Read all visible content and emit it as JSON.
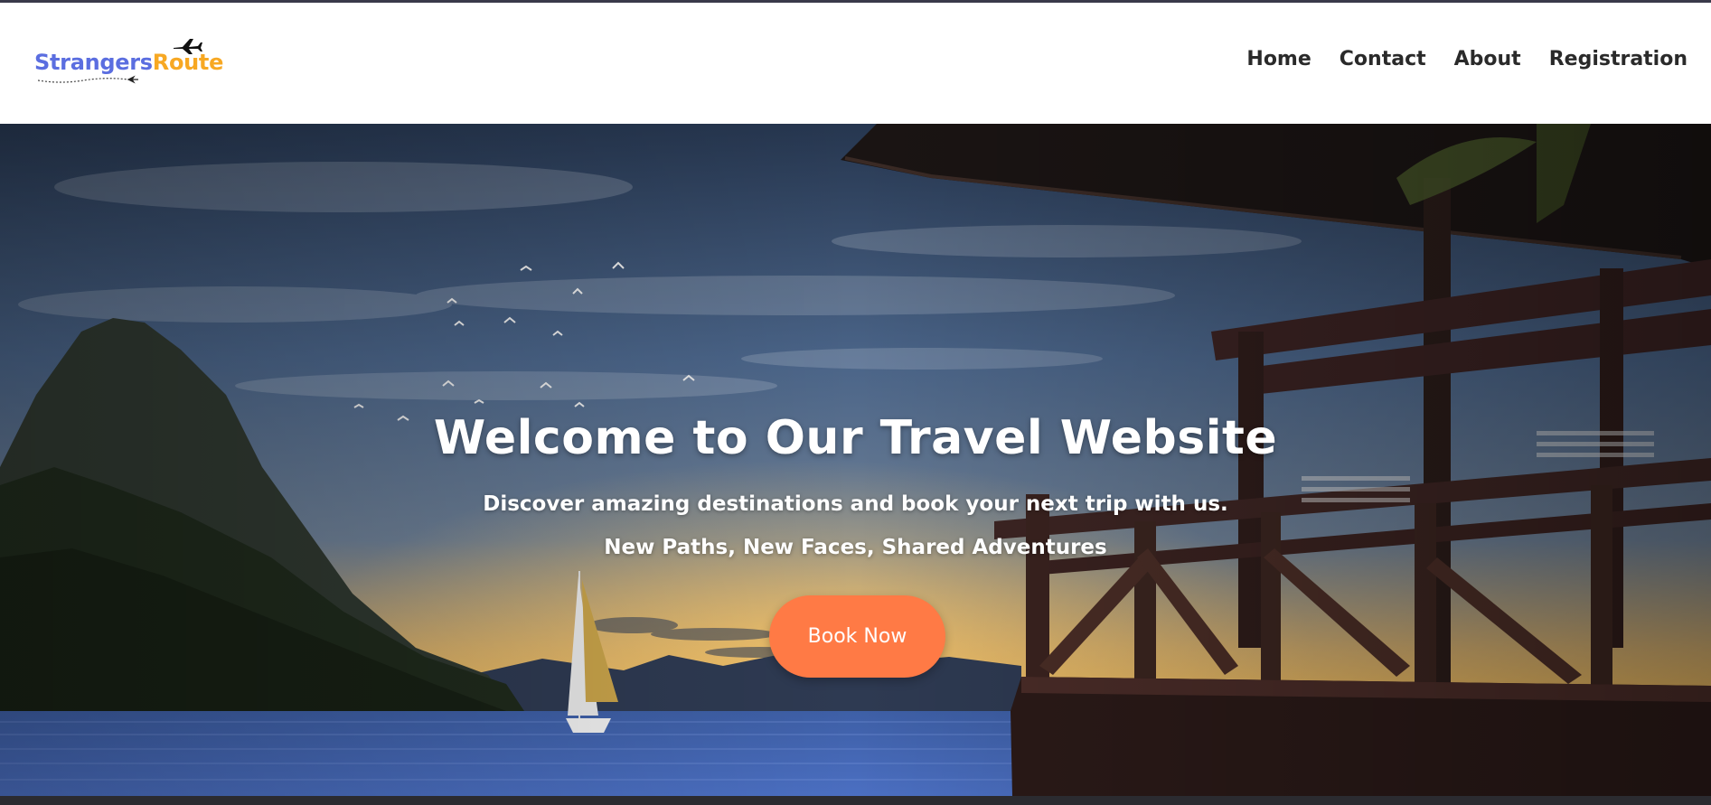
{
  "logo": {
    "part1": "Strangers",
    "part2": "Route",
    "icon": "airplane-icon"
  },
  "nav": {
    "links": [
      "Home",
      "Contact",
      "About",
      "Registration"
    ]
  },
  "hero": {
    "title": "Welcome to Our Travel Website",
    "subtitle": "Discover amazing destinations and book your next trip with us.",
    "tagline": "New Paths, New Faces, Shared Adventures",
    "button_label": "Book Now"
  },
  "colors": {
    "logo_primary": "#5b6ee0",
    "logo_accent": "#f7a823",
    "button": "#ff7a45",
    "nav_text": "#2a2a2a"
  }
}
